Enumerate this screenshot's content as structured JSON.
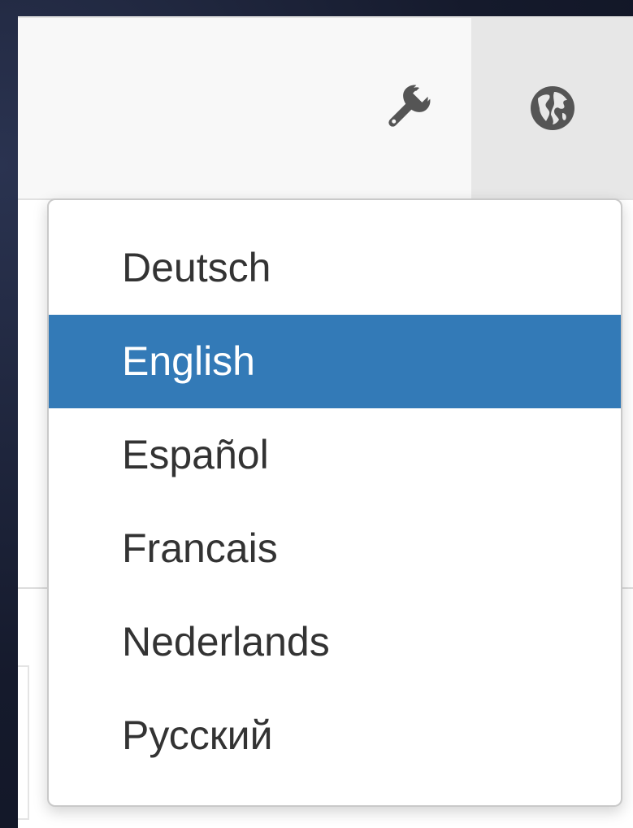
{
  "navbar": {
    "tools_icon": "wrench-icon",
    "language_icon": "globe-icon"
  },
  "language_menu": {
    "items": [
      {
        "label": "Deutsch",
        "selected": false
      },
      {
        "label": "English",
        "selected": true
      },
      {
        "label": "Español",
        "selected": false
      },
      {
        "label": "Francais",
        "selected": false
      },
      {
        "label": "Nederlands",
        "selected": false
      },
      {
        "label": "Русский",
        "selected": false
      }
    ]
  },
  "colors": {
    "accent": "#337ab7",
    "navbar_bg": "#f8f8f8",
    "active_nav_bg": "#e7e7e7",
    "icon": "#555555",
    "text": "#333333"
  }
}
